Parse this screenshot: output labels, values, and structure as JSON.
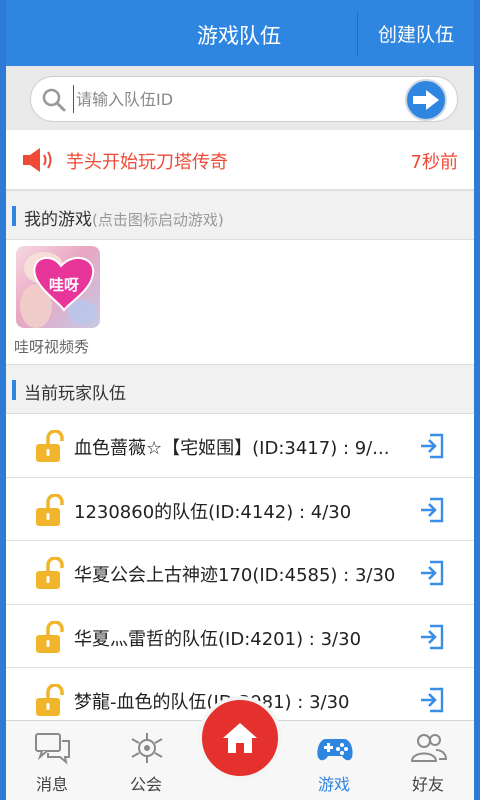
{
  "header": {
    "title": "游戏队伍",
    "action_label": "创建队伍"
  },
  "search": {
    "placeholder": "请输入队伍ID"
  },
  "notice": {
    "text": "芋头开始玩刀塔传奇",
    "time": "7秒前"
  },
  "my_games": {
    "title": "我的游戏",
    "hint": "(点击图标启动游戏)",
    "games": [
      {
        "name": "哇呀视频秀",
        "badge": "哇呀"
      }
    ]
  },
  "teams": {
    "title": "当前玩家队伍",
    "items": [
      {
        "label": "血色蔷薇☆【宅姬围】(ID:3417) : 9/..."
      },
      {
        "label": "1230860的队伍(ID:4142) : 4/30"
      },
      {
        "label": "华夏公会上古神迹170(ID:4585) : 3/30"
      },
      {
        "label": "华夏灬雷哲的队伍(ID:4201) : 3/30"
      },
      {
        "label": "梦龍-血色的队伍(ID:3981) : 3/30"
      }
    ]
  },
  "nav": {
    "items": [
      {
        "label": "消息",
        "icon": "chat-icon"
      },
      {
        "label": "公会",
        "icon": "guild-icon"
      },
      {
        "label": "游戏",
        "icon": "gamepad-icon",
        "active": true
      },
      {
        "label": "好友",
        "icon": "friends-icon"
      }
    ],
    "home_icon": "home-icon"
  },
  "colors": {
    "primary": "#2f86e0",
    "notice": "#f04a37",
    "lock": "#f1b52b",
    "home": "#e5312d"
  }
}
